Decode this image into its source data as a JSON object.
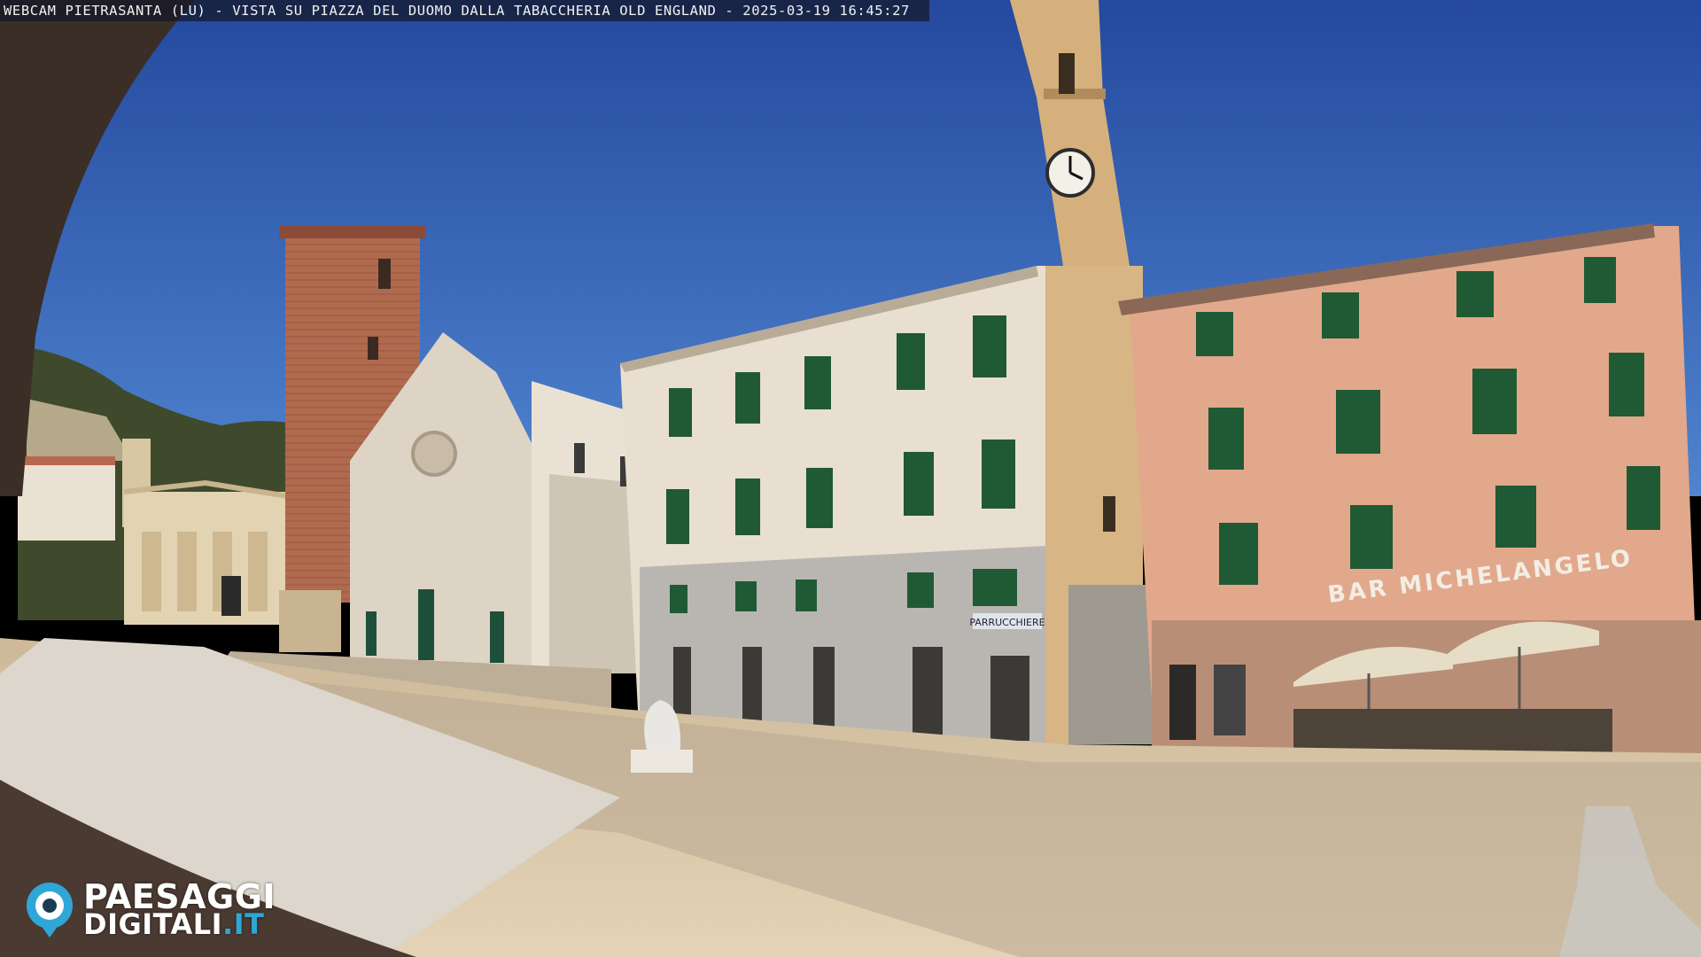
{
  "overlay": {
    "title": "WEBCAM PIETRASANTA (LU) - VISTA SU PIAZZA DEL DUOMO DALLA TABACCHERIA OLD ENGLAND - 2025-03-19 16:45:27"
  },
  "signs": {
    "bar": "BAR MICHELANGELO",
    "shop": "PARRUCCHIERE"
  },
  "logo": {
    "line1": "PAESAGGI",
    "line2_main": "DIGITALI",
    "line2_accent": ".IT"
  },
  "colors": {
    "sky": "#2f5fb8",
    "pink_building": "#e3a98b",
    "white_building": "#e6ddcf",
    "tower": "#d9b98a",
    "brick_campanile": "#b36a4f",
    "piazza": "#d8c6a8",
    "shutters": "#1f5a34",
    "logo_accent": "#2fa6d6"
  }
}
